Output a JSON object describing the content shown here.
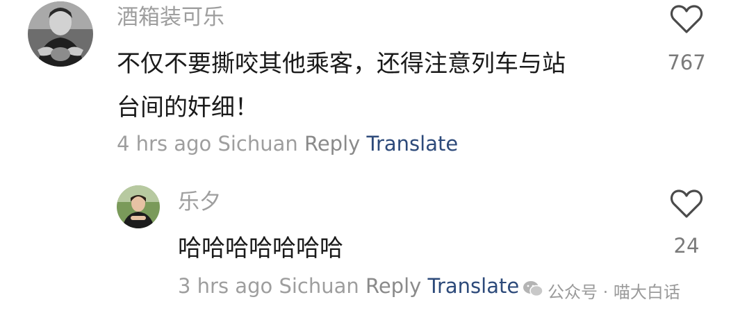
{
  "comment": {
    "username": "酒箱装可乐",
    "text_line1": "不仅不要撕咬其他乘客，还得注意列车与站",
    "text_line2": "台间的奸细！",
    "time_location": "4 hrs ago Sichuan",
    "reply_label": "Reply",
    "translate_label": "Translate",
    "like_count": "767",
    "avatar_icon": "user-photo"
  },
  "reply": {
    "username": "乐夕",
    "text": "哈哈哈哈哈哈哈",
    "time_location": "3 hrs ago Sichuan",
    "reply_label": "Reply",
    "translate_label": "Translate",
    "like_count": "24",
    "avatar_icon": "user-photo"
  },
  "watermark": {
    "text": "公众号 · 喵大白话",
    "icon": "wechat-icon"
  },
  "colors": {
    "meta_gray": "#9e9e9e",
    "translate_blue": "#2d4a7a",
    "body_text": "#1a1a1a"
  }
}
